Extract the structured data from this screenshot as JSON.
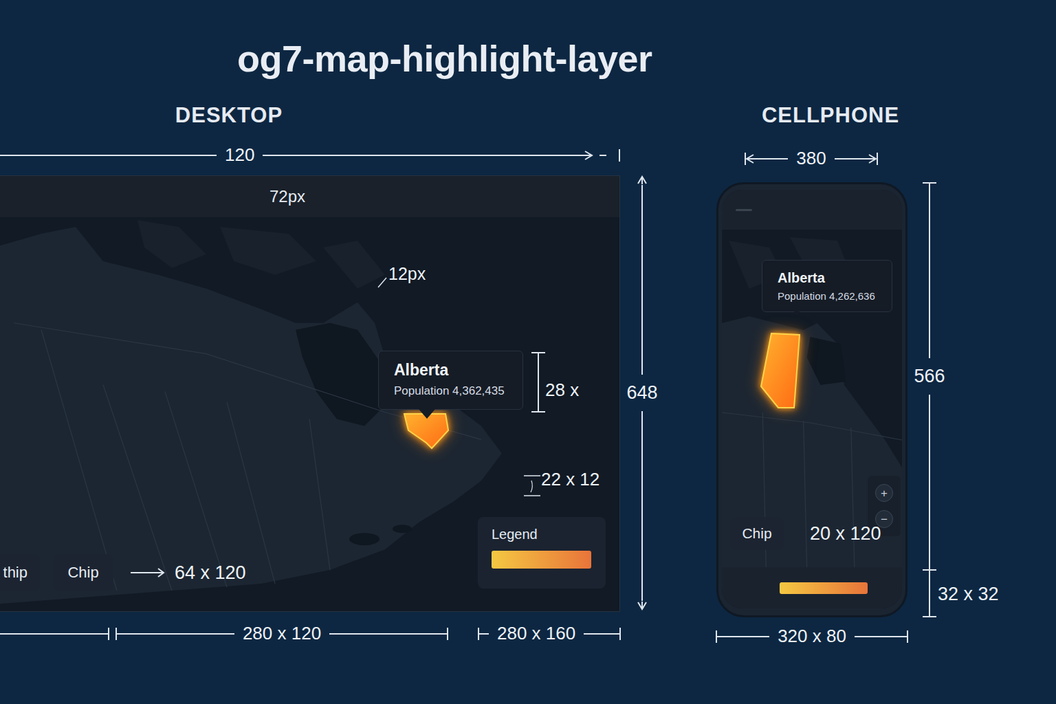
{
  "title": "og7-map-highlight-layer",
  "desktop": {
    "heading": "DESKTOP",
    "width_label": "120",
    "header_label": "72px",
    "height_label": "648",
    "annotations": {
      "spacing": "12px",
      "tooltip_height": "28 x",
      "marker": "22 x 12",
      "chip_size": "64 x 120"
    },
    "tooltip": {
      "region": "Alberta",
      "population": "Population 4,362,435"
    },
    "legend": {
      "title": "Legend"
    },
    "chips": [
      {
        "label": "thip",
        "cut": true
      },
      {
        "label": "Chip",
        "cut": false
      }
    ],
    "bottom_dims": [
      "280 x 120",
      "280 x 160"
    ]
  },
  "cellphone": {
    "heading": "CELLPHONE",
    "width_label": "380",
    "height_label": "566",
    "tooltip": {
      "region": "Alberta",
      "population": "Population 4,262,636"
    },
    "zoom": [
      "+",
      "−"
    ],
    "chip": "Chip",
    "chip_size": "20 x 120",
    "bottom_bar_size": "32 x 32",
    "bottom_dim": "320 x 80"
  }
}
